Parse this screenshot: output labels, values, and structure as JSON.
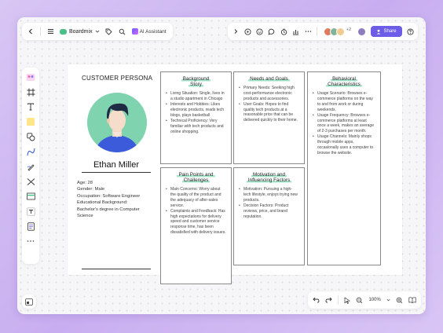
{
  "topbar": {
    "app_name": "Boardmix",
    "ai_label": "AI Assistant",
    "share_label": "Share",
    "collaborators_extra": "+2"
  },
  "persona": {
    "section_title": "CUSTOMER PERSONA",
    "name": "Ethan Miller",
    "info_lines": [
      "Age: 28",
      "Gender: Male",
      "Occupation: Software Engineer",
      "Educational Background:",
      "Bachelor's degree in Computer",
      "Science"
    ]
  },
  "cards": [
    {
      "title": [
        "Background",
        "Story"
      ],
      "bullets": [
        "Living Situation: Single, lives in a studio apartment in Chicago",
        "Interests and Hobbies: Likes electronic products, reads tech blogs, plays basketball",
        "Technical Proficiency: Very familiar with tech products and online shopping."
      ]
    },
    {
      "title": [
        "Needs and Goals"
      ],
      "bullets": [
        "Primary Needs: Seeking high cost-performance electronic products and accessories.",
        "User Goals: Hopes to find quality tech products at a reasonable price that can be delivered quickly to their home."
      ]
    },
    {
      "title": [
        "Behavioral",
        "Characteristics"
      ],
      "bullets": [
        "Usage Scenario: Browses e-commerce platforms on the way to and from work or during weekends.",
        "Usage Frequency: Browses e-commerce platforms at least once a week, makes an average of 2-3 purchases per month.",
        "Usage Channels: Mainly shops through mobile apps, occasionally uses a computer to browse the website."
      ]
    },
    {
      "title": [
        "Pain Points and",
        "Challenges"
      ],
      "bullets": [
        "Main Concerns: Worry about the quality of the product and the adequacy of after-sales service.",
        "Complaints and Feedback: Has high expectations for delivery speed and customer service response time, has been dissatisfied with delivery issues."
      ]
    },
    {
      "title": [
        "Motivation and",
        "Influencing Factors"
      ],
      "bullets": [
        "Motivation: Pursuing a high-tech lifestyle, enjoys trying new products.",
        "Decision Factors: Product reviews, price, and brand reputation."
      ]
    }
  ],
  "bottombar": {
    "zoom": "100%"
  },
  "colors": {
    "accent": "#6c5ce7",
    "avatar_bg": "#7fd3ae",
    "highlight": "#a8e6cc",
    "shirt": "#3b5bdb"
  }
}
